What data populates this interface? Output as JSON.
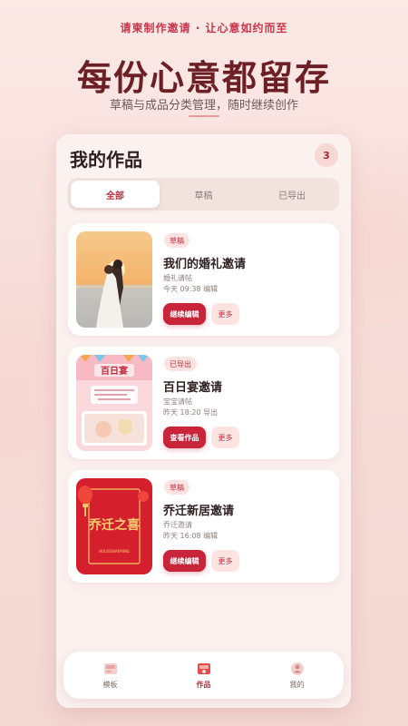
{
  "hero": {
    "tagline": "请柬制作邀请 · 让心意如约而至",
    "headline": "每份心意都留存",
    "subline": "草稿与成品分类管理，随时继续创作"
  },
  "works": {
    "title": "我的作品",
    "count": "3",
    "tabs": [
      "全部",
      "草稿",
      "已导出"
    ],
    "active_tab": "全部",
    "items": [
      {
        "badge": "草稿",
        "title": "我们的婚礼邀请",
        "subtitle": "婚礼请帖",
        "time": "今天 09:38 编辑",
        "primary": "继续编辑",
        "more": "更多",
        "thumb": "wedding-photo"
      },
      {
        "badge": "已导出",
        "title": "百日宴邀请",
        "subtitle": "宝宝请帖",
        "time": "昨天 18:20 导出",
        "primary": "查看作品",
        "more": "更多",
        "thumb": "baby-banquet",
        "thumb_text": "百日宴"
      },
      {
        "badge": "草稿",
        "title": "乔迁新居邀请",
        "subtitle": "乔迁邀请",
        "time": "昨天 16:08 编辑",
        "primary": "继续编辑",
        "more": "更多",
        "thumb": "housewarming",
        "thumb_text": "乔迁之喜",
        "thumb_en": "HOUSEWARMING"
      }
    ]
  },
  "nav": [
    {
      "label": "模板",
      "icon": "template-icon"
    },
    {
      "label": "作品",
      "icon": "works-icon",
      "active": true
    },
    {
      "label": "我的",
      "icon": "profile-icon"
    }
  ],
  "colors": {
    "accent": "#c8243a",
    "brand_dark": "#6d1f26",
    "badge_bg": "#fde3e0"
  }
}
